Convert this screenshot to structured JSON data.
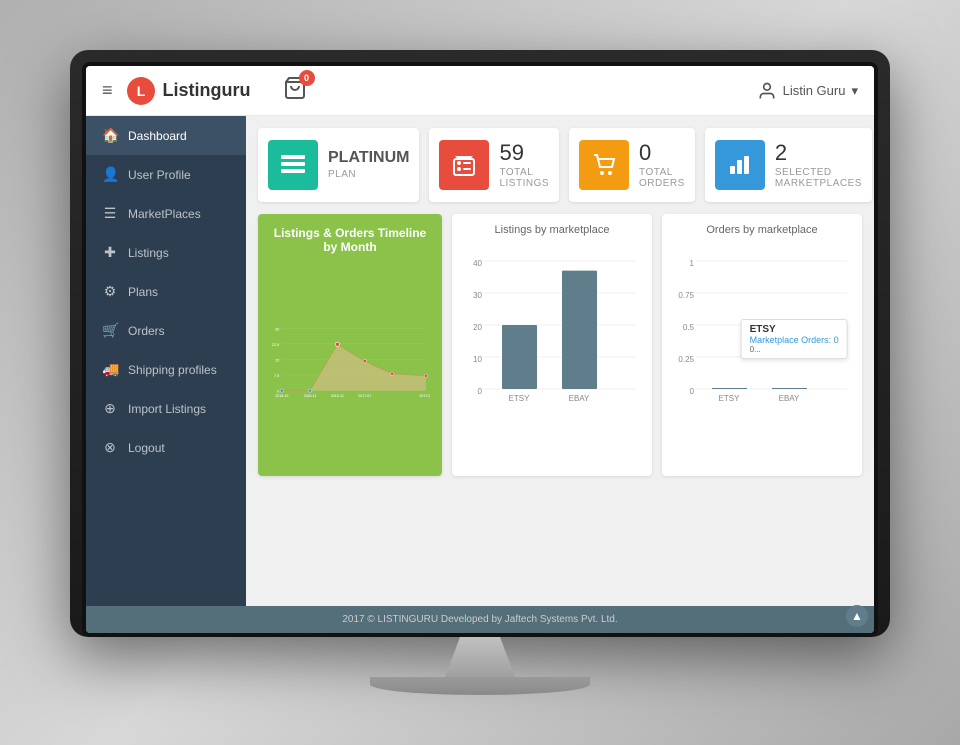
{
  "app": {
    "title": "Listinguru",
    "logo_text": "Listinguru"
  },
  "topbar": {
    "cart_badge": "0",
    "user_name": "Listin Guru",
    "menu_icon": "≡"
  },
  "sidebar": {
    "items": [
      {
        "id": "dashboard",
        "label": "Dashboard",
        "icon": "🏠",
        "active": true
      },
      {
        "id": "user-profile",
        "label": "User Profile",
        "icon": "👤",
        "active": false
      },
      {
        "id": "marketplaces",
        "label": "MarketPlaces",
        "icon": "☰",
        "active": false
      },
      {
        "id": "listings",
        "label": "Listings",
        "icon": "✚",
        "active": false
      },
      {
        "id": "plans",
        "label": "Plans",
        "icon": "⚙",
        "active": false
      },
      {
        "id": "orders",
        "label": "Orders",
        "icon": "🛒",
        "active": false
      },
      {
        "id": "shipping",
        "label": "Shipping profiles",
        "icon": "🚚",
        "active": false
      },
      {
        "id": "import",
        "label": "Import Listings",
        "icon": "⊕",
        "active": false
      },
      {
        "id": "logout",
        "label": "Logout",
        "icon": "⊗",
        "active": false
      }
    ]
  },
  "stats": [
    {
      "id": "platinum",
      "icon_type": "teal",
      "icon_symbol": "≡",
      "text": "PLATINUM",
      "sublabel": "PLAN"
    },
    {
      "id": "total-listings",
      "icon_type": "coral",
      "icon_symbol": "🏷",
      "value": "59",
      "label": "TOTAL LISTINGS"
    },
    {
      "id": "total-orders",
      "icon_type": "yellow",
      "icon_symbol": "🛒",
      "value": "0",
      "label": "TOTAL ORDERS"
    },
    {
      "id": "marketplaces",
      "icon_type": "blue",
      "icon_symbol": "📊",
      "value": "2",
      "label": "SELECTED MARKETPLACES"
    }
  ],
  "main_chart": {
    "title": "Listings & Orders Timeline by Month",
    "x_labels": [
      "2016-10",
      "2016-11",
      "2016-12",
      "2017-01",
      "2017-02"
    ],
    "y_labels": [
      "0",
      "7.5",
      "15",
      "22.5",
      "30"
    ],
    "color": "#8bc34a"
  },
  "listings_chart": {
    "title": "Listings by marketplace",
    "bars": [
      {
        "label": "ETSY",
        "value": 20,
        "max": 40
      },
      {
        "label": "EBAY",
        "value": 37,
        "max": 40
      }
    ],
    "y_labels": [
      "0",
      "10",
      "20",
      "30",
      "40"
    ]
  },
  "orders_chart": {
    "title": "Orders by marketplace",
    "bars": [
      {
        "label": "ETSY",
        "value": 0,
        "max": 1
      },
      {
        "label": "EBAY",
        "value": 0,
        "max": 1
      }
    ],
    "y_labels": [
      "0",
      "0.25",
      "0.5",
      "0.75",
      "1"
    ],
    "tooltip": {
      "title": "ETSY",
      "subtitle": "Marketplace Orders: 0"
    }
  },
  "footer": {
    "text": "2017 © LISTINGURU Developed by Jaftech Systems Pvt. Ltd."
  }
}
